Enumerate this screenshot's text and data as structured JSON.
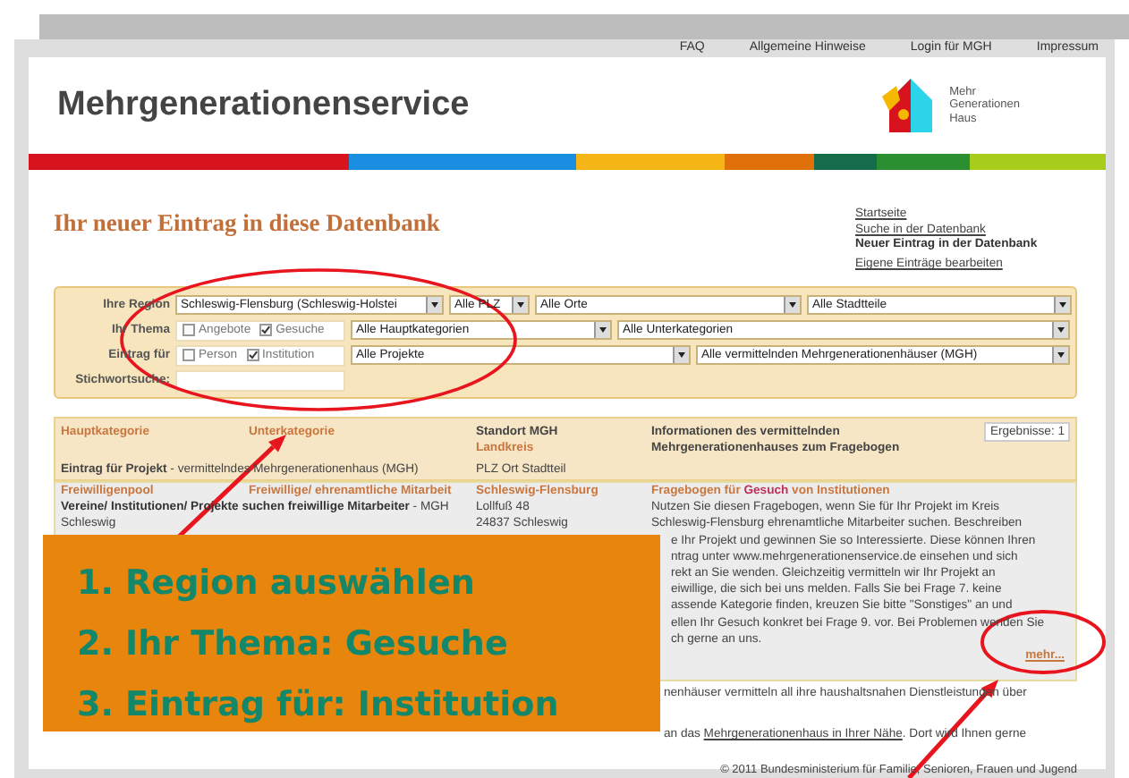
{
  "top_nav": [
    {
      "label": "FAQ"
    },
    {
      "label": "Allgemeine Hinweise"
    },
    {
      "label": "Login für MGH"
    },
    {
      "label": "Impressum"
    }
  ],
  "header": {
    "title": "Mehrgenerationenservice",
    "logo_lines": [
      "Mehr",
      "Generationen",
      "Haus"
    ]
  },
  "page_heading": "Ihr neuer Eintrag in diese Datenbank",
  "side_links": [
    {
      "label": "Startseite",
      "selected": false
    },
    {
      "label": "Suche in der Datenbank",
      "selected": false
    },
    {
      "label": "Neuer Eintrag in der Datenbank",
      "selected": true
    },
    {
      "label": "Eigene Einträge bearbeiten",
      "selected": false
    }
  ],
  "filters": {
    "region": {
      "label": "Ihre Region",
      "selects": [
        "Schleswig-Flensburg (Schleswig-Holstei",
        "Alle PLZ",
        "Alle Orte",
        "Alle Stadtteile"
      ]
    },
    "thema": {
      "label": "Ihr Thema",
      "checkboxes": [
        {
          "label": "Angebote",
          "checked": false
        },
        {
          "label": "Gesuche",
          "checked": true
        }
      ],
      "selects": [
        "Alle Hauptkategorien",
        "Alle Unterkategorien"
      ]
    },
    "eintrag_fuer": {
      "label": "Eintrag für",
      "checkboxes": [
        {
          "label": "Person",
          "checked": false
        },
        {
          "label": "Institution",
          "checked": true
        }
      ],
      "selects": [
        "Alle Projekte",
        "Alle vermittelnden Mehrgenerationenhäuser (MGH)"
      ]
    },
    "keyword": {
      "label": "Stichwortsuche:"
    }
  },
  "table": {
    "columns": {
      "hauptkategorie": "Hauptkategorie",
      "unterkategorie": "Unterkategorie",
      "standort": "Standort MGH",
      "landkreis": "Landkreis",
      "info": "Informationen des vermittelnden Mehrgenerationenhauses zum Fragebogen",
      "eintrag": "**Eintrag für Projekt** - vermittelndes Mehrgenerationenhaus (MGH)",
      "ort": "PLZ Ort Stadtteil"
    },
    "results_count": "Ergebnisse: 1",
    "rows": [
      {
        "hauptkategorie": "Freiwilligenpool",
        "unterkategorie": "Freiwillige/ ehrenamtliche Mitarbeit",
        "landkreis": "Schleswig-Flensburg",
        "title": "**Vereine/ Institutionen/ Projekte suchen freiwillige Mitarbeiter** - MGH Schleswig",
        "address": [
          "Lollfuß 48",
          "24837 Schleswig"
        ],
        "info_title": "Fragebogen für **Gesuch** von Institutionen",
        "description": [
          "Nutzen Sie diesen Fragebogen, wenn Sie für Ihr Projekt im Kreis",
          "Schleswig-Flensburg ehrenamtliche Mitarbeiter suchen. Beschreiben",
          "e Ihr Projekt und gewinnen Sie so Interessierte. Diese können Ihren",
          "ntrag unter www.mehrgenerationenservice.de einsehen und sich",
          "rekt an Sie wenden. Gleichzeitig vermitteln wir Ihr Projekt an",
          "eiwillige, die sich bei uns melden. Falls Sie bei Frage 7. keine",
          "assende Kategorie finden, kreuzen Sie bitte \"Sonstiges\" an und",
          "ellen Ihr Gesuch konkret bei Frage 9. vor. Bei Problemen wenden Sie",
          "ch gerne an uns."
        ],
        "more_link": "mehr..."
      }
    ]
  },
  "notes": [
    {
      "text": "nenhäuser vermitteln all ihre haushaltsnahen Dienstleistungen über"
    },
    {
      "text": "an das ",
      "link": "Mehrgenerationenhaus in Ihrer Nähe",
      "after": ". Dort wird Ihnen gerne"
    }
  ],
  "footer": "© 2011 Bundesministerium für Familie, Senioren, Frauen und Jugend",
  "callout": {
    "lines": [
      "1. Region auswählen",
      "2. Ihr Thema: Gesuche",
      "3. Eintrag für: Institution"
    ]
  }
}
